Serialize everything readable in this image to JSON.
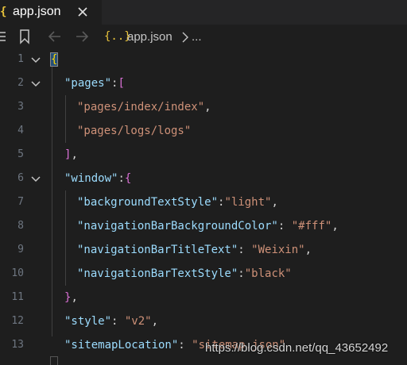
{
  "tab": {
    "name": "app.json",
    "badge": "{"
  },
  "breadcrumb": {
    "file_icon": "{..}",
    "file": "app.json",
    "more": "..."
  },
  "editor": {
    "lines": [
      {
        "n": "1",
        "fold": true
      },
      {
        "n": "2",
        "fold": true
      },
      {
        "n": "3",
        "fold": false
      },
      {
        "n": "4",
        "fold": false
      },
      {
        "n": "5",
        "fold": false
      },
      {
        "n": "6",
        "fold": true
      },
      {
        "n": "7",
        "fold": false
      },
      {
        "n": "8",
        "fold": false
      },
      {
        "n": "9",
        "fold": false
      },
      {
        "n": "10",
        "fold": false
      },
      {
        "n": "11",
        "fold": false
      },
      {
        "n": "12",
        "fold": false
      },
      {
        "n": "13",
        "fold": false
      }
    ],
    "code": {
      "l1": {
        "open": "{"
      },
      "l2": {
        "key": "\"pages\"",
        "colon": ":",
        "open": "["
      },
      "l3": {
        "val": "\"pages/index/index\"",
        "comma": ","
      },
      "l4": {
        "val": "\"pages/logs/logs\""
      },
      "l5": {
        "close": "]",
        "comma": ","
      },
      "l6": {
        "key": "\"window\"",
        "colon": ":",
        "open": "{"
      },
      "l7": {
        "key": "\"backgroundTextStyle\"",
        "colon": ":",
        "val": "\"light\"",
        "comma": ","
      },
      "l8": {
        "key": "\"navigationBarBackgroundColor\"",
        "colon": ": ",
        "val": "\"#fff\"",
        "comma": ","
      },
      "l9": {
        "key": "\"navigationBarTitleText\"",
        "colon": ": ",
        "val": "\"Weixin\"",
        "comma": ","
      },
      "l10": {
        "key": "\"navigationBarTextStyle\"",
        "colon": ":",
        "val": "\"black\""
      },
      "l11": {
        "close": "}",
        "comma": ","
      },
      "l12": {
        "key": "\"style\"",
        "colon": ": ",
        "val": "\"v2\"",
        "comma": ","
      },
      "l13": {
        "key": "\"sitemapLocation\"",
        "colon": ": ",
        "val": "\"sitemap.json\""
      }
    }
  },
  "watermark": "https://blog.csdn.net/qq_43652492",
  "colors": {
    "background": "#1e1e1e",
    "key": "#9cdcfe",
    "string": "#ce9178",
    "bracket1": "#ffd700",
    "bracket2": "#da70d6"
  }
}
